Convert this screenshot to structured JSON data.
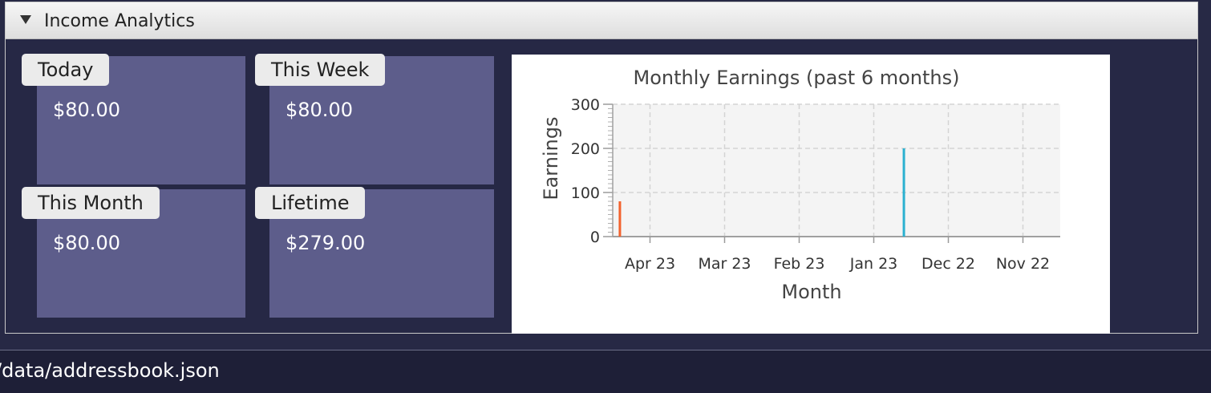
{
  "pane": {
    "title": "Income Analytics"
  },
  "cards": {
    "today": {
      "label": "Today",
      "value": "$80.00"
    },
    "this_week": {
      "label": "This Week",
      "value": "$80.00"
    },
    "this_month": {
      "label": "This Month",
      "value": "$80.00"
    },
    "lifetime": {
      "label": "Lifetime",
      "value": "$279.00"
    }
  },
  "colors": {
    "card_bg": "#5d5d8b",
    "series_1": "#f3622d",
    "series_2": "#2bb0d0"
  },
  "chart_data": {
    "type": "bar",
    "title": "Monthly Earnings (past 6 months)",
    "xlabel": "Month",
    "ylabel": "Earnings",
    "categories": [
      "Apr 23",
      "Mar 23",
      "Feb 23",
      "Jan 23",
      "Dec 22",
      "Nov 22"
    ],
    "ylim": [
      0,
      300
    ],
    "yticks": [
      0,
      100,
      200,
      300
    ],
    "grid": true,
    "legend": "none",
    "series": [
      {
        "values": [
          80,
          0,
          0,
          0,
          0,
          0
        ]
      },
      {
        "values": [
          0,
          0,
          0,
          200,
          0,
          0
        ]
      }
    ]
  },
  "status": {
    "path": "/data/addressbook.json"
  }
}
